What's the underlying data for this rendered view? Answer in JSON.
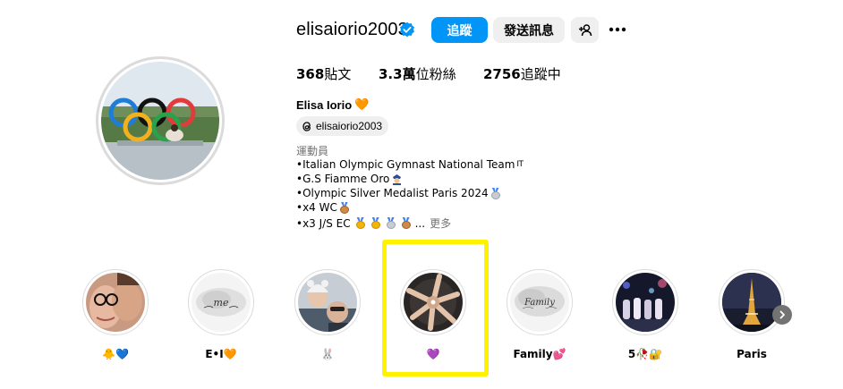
{
  "profile": {
    "username": "elisaiorio2003",
    "follow_label": "追蹤",
    "message_label": "發送訊息",
    "full_name": "Elisa Iorio",
    "name_emoji": "🧡",
    "threads_handle": "elisaiorio2003",
    "category": "運動員"
  },
  "stats": {
    "posts_num": "368",
    "posts_label": "貼文",
    "followers_num": "3.3萬",
    "followers_label": "位粉絲",
    "following_num": "2756",
    "following_label": "追蹤中"
  },
  "bio": {
    "line1": "•Italian Olympic Gymnast National Team",
    "line1_flag": "IT",
    "line2": "•G.S Fiamme Oro",
    "line3": "•Olympic Silver Medalist Paris 2024",
    "line4": "•x4 WC",
    "line5": "•x3 J/S EC",
    "line5_ellipsis": "...",
    "more_label": "更多"
  },
  "highlights": [
    {
      "label": "🐥💙"
    },
    {
      "label": "E•I🧡"
    },
    {
      "label": "🐰"
    },
    {
      "label": "💜"
    },
    {
      "label": "Family💕"
    },
    {
      "label": "5🥀🔐"
    },
    {
      "label": "Paris"
    }
  ],
  "colors": {
    "accent": "#0095f6",
    "annotation": "#fff200"
  },
  "icons": {
    "verified": "verified-badge-icon",
    "suggest": "person-add-icon",
    "more": "more-options-icon",
    "threads": "threads-icon",
    "next": "chevron-right-icon"
  }
}
